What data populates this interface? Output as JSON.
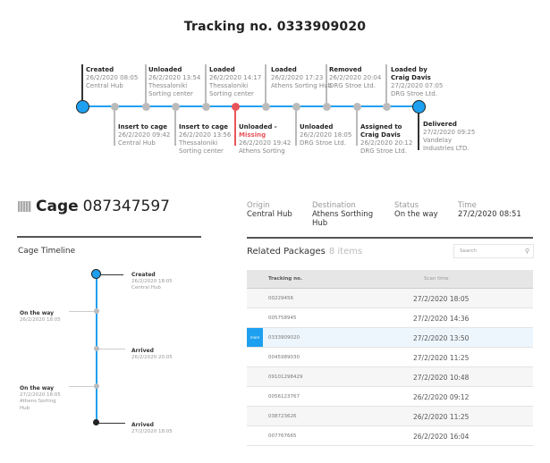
{
  "header": {
    "title": "Tracking no. 0333909020"
  },
  "tracking_timeline": {
    "events_top": [
      {
        "title": "Created",
        "time": "26/2/2020 08:05",
        "place": [
          "Central Hub"
        ]
      },
      {
        "title": "Unloaded",
        "time": "26/2/2020 13:54",
        "place": [
          "Thessaloniki",
          "Sorting center"
        ]
      },
      {
        "title": "Loaded",
        "time": "26/2/2020 14:17",
        "place": [
          "Thessaloniki",
          "Sorting center"
        ]
      },
      {
        "title": "Loaded",
        "time": "26/2/2020 17:23",
        "place": [
          "Athens Sorting Hub"
        ]
      },
      {
        "title": "Removed",
        "time": "26/2/2020 20:04",
        "place": [
          "DRG Stroe Ltd."
        ]
      },
      {
        "title": "Loaded by",
        "title2": "Craig Davis",
        "time": "27/2/2020 07:05",
        "place": [
          "DRG Stroe Ltd."
        ]
      }
    ],
    "events_bottom": [
      {
        "title": "Insert to cage",
        "time": "26/2/2020 09:42",
        "place": [
          "Central Hub"
        ]
      },
      {
        "title": "Insert to cage",
        "time": "26/2/2020 13:56",
        "place": [
          "Thessaloniki",
          "Sorting center"
        ]
      },
      {
        "title": "Unloaded -",
        "title2": "Missing",
        "time": "26/2/2020 19:42",
        "place": [
          "Athens Sorting"
        ]
      },
      {
        "title": "Unloaded",
        "time": "26/2/2020 18:05",
        "place": [
          "DRG Stroe Ltd."
        ]
      },
      {
        "title": "Assigned to",
        "title2": "Craig Davis",
        "time": "26/2/2020 20:12",
        "place": [
          "DRG Stroe Ltd."
        ]
      },
      {
        "title": "Delivered",
        "time": "27/2/2020 09:25",
        "place": [
          "Vandelay",
          "Industries LTD."
        ]
      }
    ]
  },
  "cage": {
    "label": "Cage",
    "number": "087347597",
    "timeline_title": "Cage Timeline",
    "events": [
      {
        "title": "Created",
        "time": "26/2/2020 18:05",
        "place": "Central  Hub"
      },
      {
        "title": "On the way",
        "time": "26/2/2020 18:05"
      },
      {
        "title": "Arrived",
        "time": "26/2/2020 20:05"
      },
      {
        "title": "On the way",
        "time": "27/2/2020 18:05",
        "place": "Athens Sorting",
        "place2": "Hub"
      },
      {
        "title": "Arrived",
        "time": "27/2/2020 18:05"
      }
    ]
  },
  "info": {
    "origin_label": "Origin",
    "origin": "Central Hub",
    "destination_label": "Destination",
    "destination": "Athens Sorthing",
    "destination2": "Hub",
    "status_label": "Status",
    "status": "On the way",
    "time_label": "Time",
    "time": "27/2/2020 08:51"
  },
  "related": {
    "title": "Related Packages",
    "count": "8 items",
    "search_placeholder": "Search",
    "columns": [
      "Tracking no.",
      "Scan  time"
    ],
    "more_label": "more",
    "rows": [
      {
        "tracking": "00229456",
        "scan": "27/2/2020 18:05"
      },
      {
        "tracking": "005758945",
        "scan": "27/2/2020 14:36"
      },
      {
        "tracking": "0333909020",
        "scan": "27/2/2020 13:50"
      },
      {
        "tracking": "0045989030",
        "scan": "27/2/2020 11:25"
      },
      {
        "tracking": "09101298429",
        "scan": "27/2/2020 10:48"
      },
      {
        "tracking": "0056123767",
        "scan": "26/2/2020 09:12"
      },
      {
        "tracking": "038723626",
        "scan": "26/2/2020 11:25"
      },
      {
        "tracking": "007767665",
        "scan": "26/2/2020 16:04"
      }
    ]
  }
}
